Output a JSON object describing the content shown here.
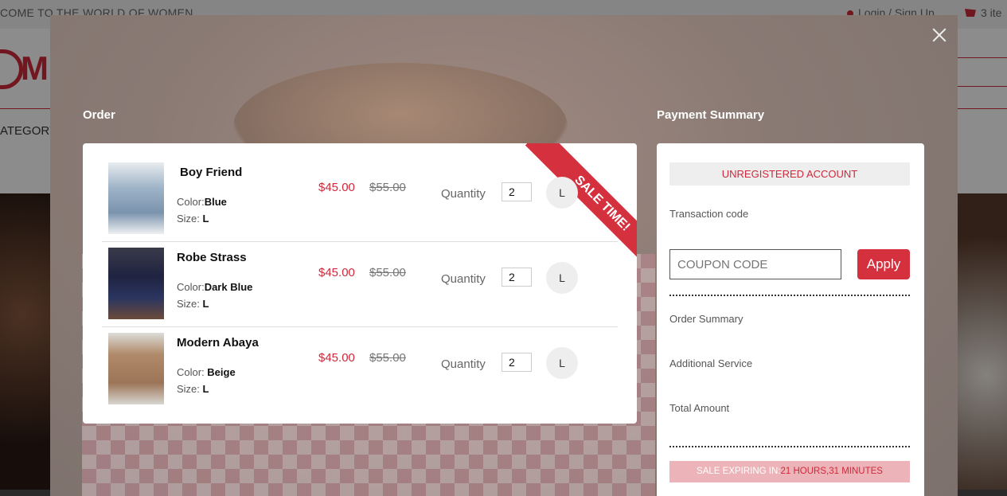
{
  "site": {
    "welcome": "COME TO THE WORLD OF WOMEN",
    "login": "Login / Sign Up",
    "cart": "3 ite",
    "category": "ATEGORY"
  },
  "modal": {
    "order_title": "Order",
    "payment_title": "Payment Summary",
    "ribbon": "SALE TIME!",
    "items": [
      {
        "name": "Boy Friend",
        "color_label": "Color:",
        "color": "Blue",
        "size_label": "Size: ",
        "size": "L",
        "price": "$45.00",
        "old_price": "$55.00",
        "qty_label": "Quantity",
        "qty": "2",
        "size_badge": "L"
      },
      {
        "name": "Robe Strass",
        "color_label": "Color:",
        "color": "Dark Blue",
        "size_label": "Size: ",
        "size": "L",
        "price": "$45.00",
        "old_price": "$55.00",
        "qty_label": "Quantity",
        "qty": "2",
        "size_badge": "L"
      },
      {
        "name": "Modern Abaya",
        "color_label": "Color: ",
        "color": "Beige",
        "size_label": "Size: ",
        "size": "L",
        "price": "$45.00",
        "old_price": "$55.00",
        "qty_label": "Quantity",
        "qty": "2",
        "size_badge": "L"
      }
    ],
    "payment": {
      "account": "UNREGISTERED ACCOUNT",
      "transaction": "Transaction code",
      "coupon_placeholder": "COUPON CODE",
      "apply": "Apply",
      "order_summary": "Order Summary",
      "additional": "Additional Service",
      "total": "Total Amount",
      "expire_label": "SALE EXPIRING IN:",
      "expire_value": "21 HOURS,31 MINUTES"
    }
  },
  "colors": {
    "accent": "#d5303e",
    "price": "#d0283a"
  }
}
